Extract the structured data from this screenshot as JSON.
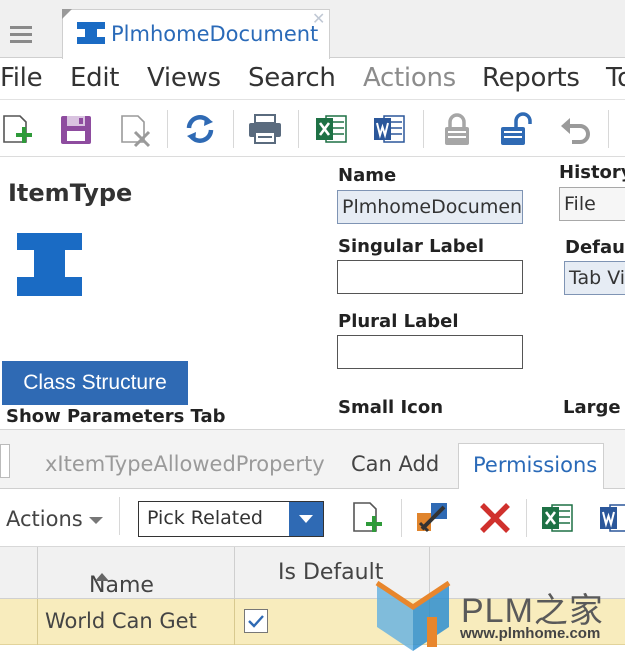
{
  "window": {
    "tab_title": "PlmhomeDocument",
    "tab_icon": "itemtype-icon",
    "close_glyph": "✕"
  },
  "menu": {
    "items": [
      "File",
      "Edit",
      "Views",
      "Search",
      "Actions",
      "Reports",
      "To"
    ],
    "disabled": [
      "Actions"
    ]
  },
  "toolbar": {
    "buttons": [
      "new-icon",
      "save-icon",
      "delete-icon",
      "refresh-icon",
      "print-icon",
      "excel-icon",
      "word-icon",
      "lock-icon",
      "unlock-icon",
      "undo-icon"
    ]
  },
  "form": {
    "title": "ItemType",
    "class_structure_label": "Class Structure",
    "show_parameters_label": "Show Parameters Tab",
    "name_label": "Name",
    "name_value": "PlmhomeDocument",
    "singular_label": "Singular Label",
    "singular_value": "",
    "plural_label": "Plural Label",
    "plural_value": "",
    "small_icon_label": "Small Icon",
    "history_label": "History",
    "history_value": "File",
    "default_label": "Defaul",
    "default_value": "Tab Vi",
    "large_label": "Large I"
  },
  "relationships": {
    "tabs": [
      "xItemTypeAllowedProperty",
      "Can Add",
      "Permissions"
    ],
    "active_tab": "Permissions",
    "actions_label": "Actions",
    "pick_value": "Pick Related",
    "columns": [
      "Name",
      "Is Default"
    ],
    "rows": [
      {
        "name": "World Can Get",
        "is_default": true
      }
    ]
  },
  "watermark": {
    "brand": "PLM之家",
    "url": "www.plmhome.com"
  },
  "colors": {
    "accent": "#2f6ab4",
    "link_blue": "#2a6ab8",
    "selected_row": "#f8ecbd"
  }
}
